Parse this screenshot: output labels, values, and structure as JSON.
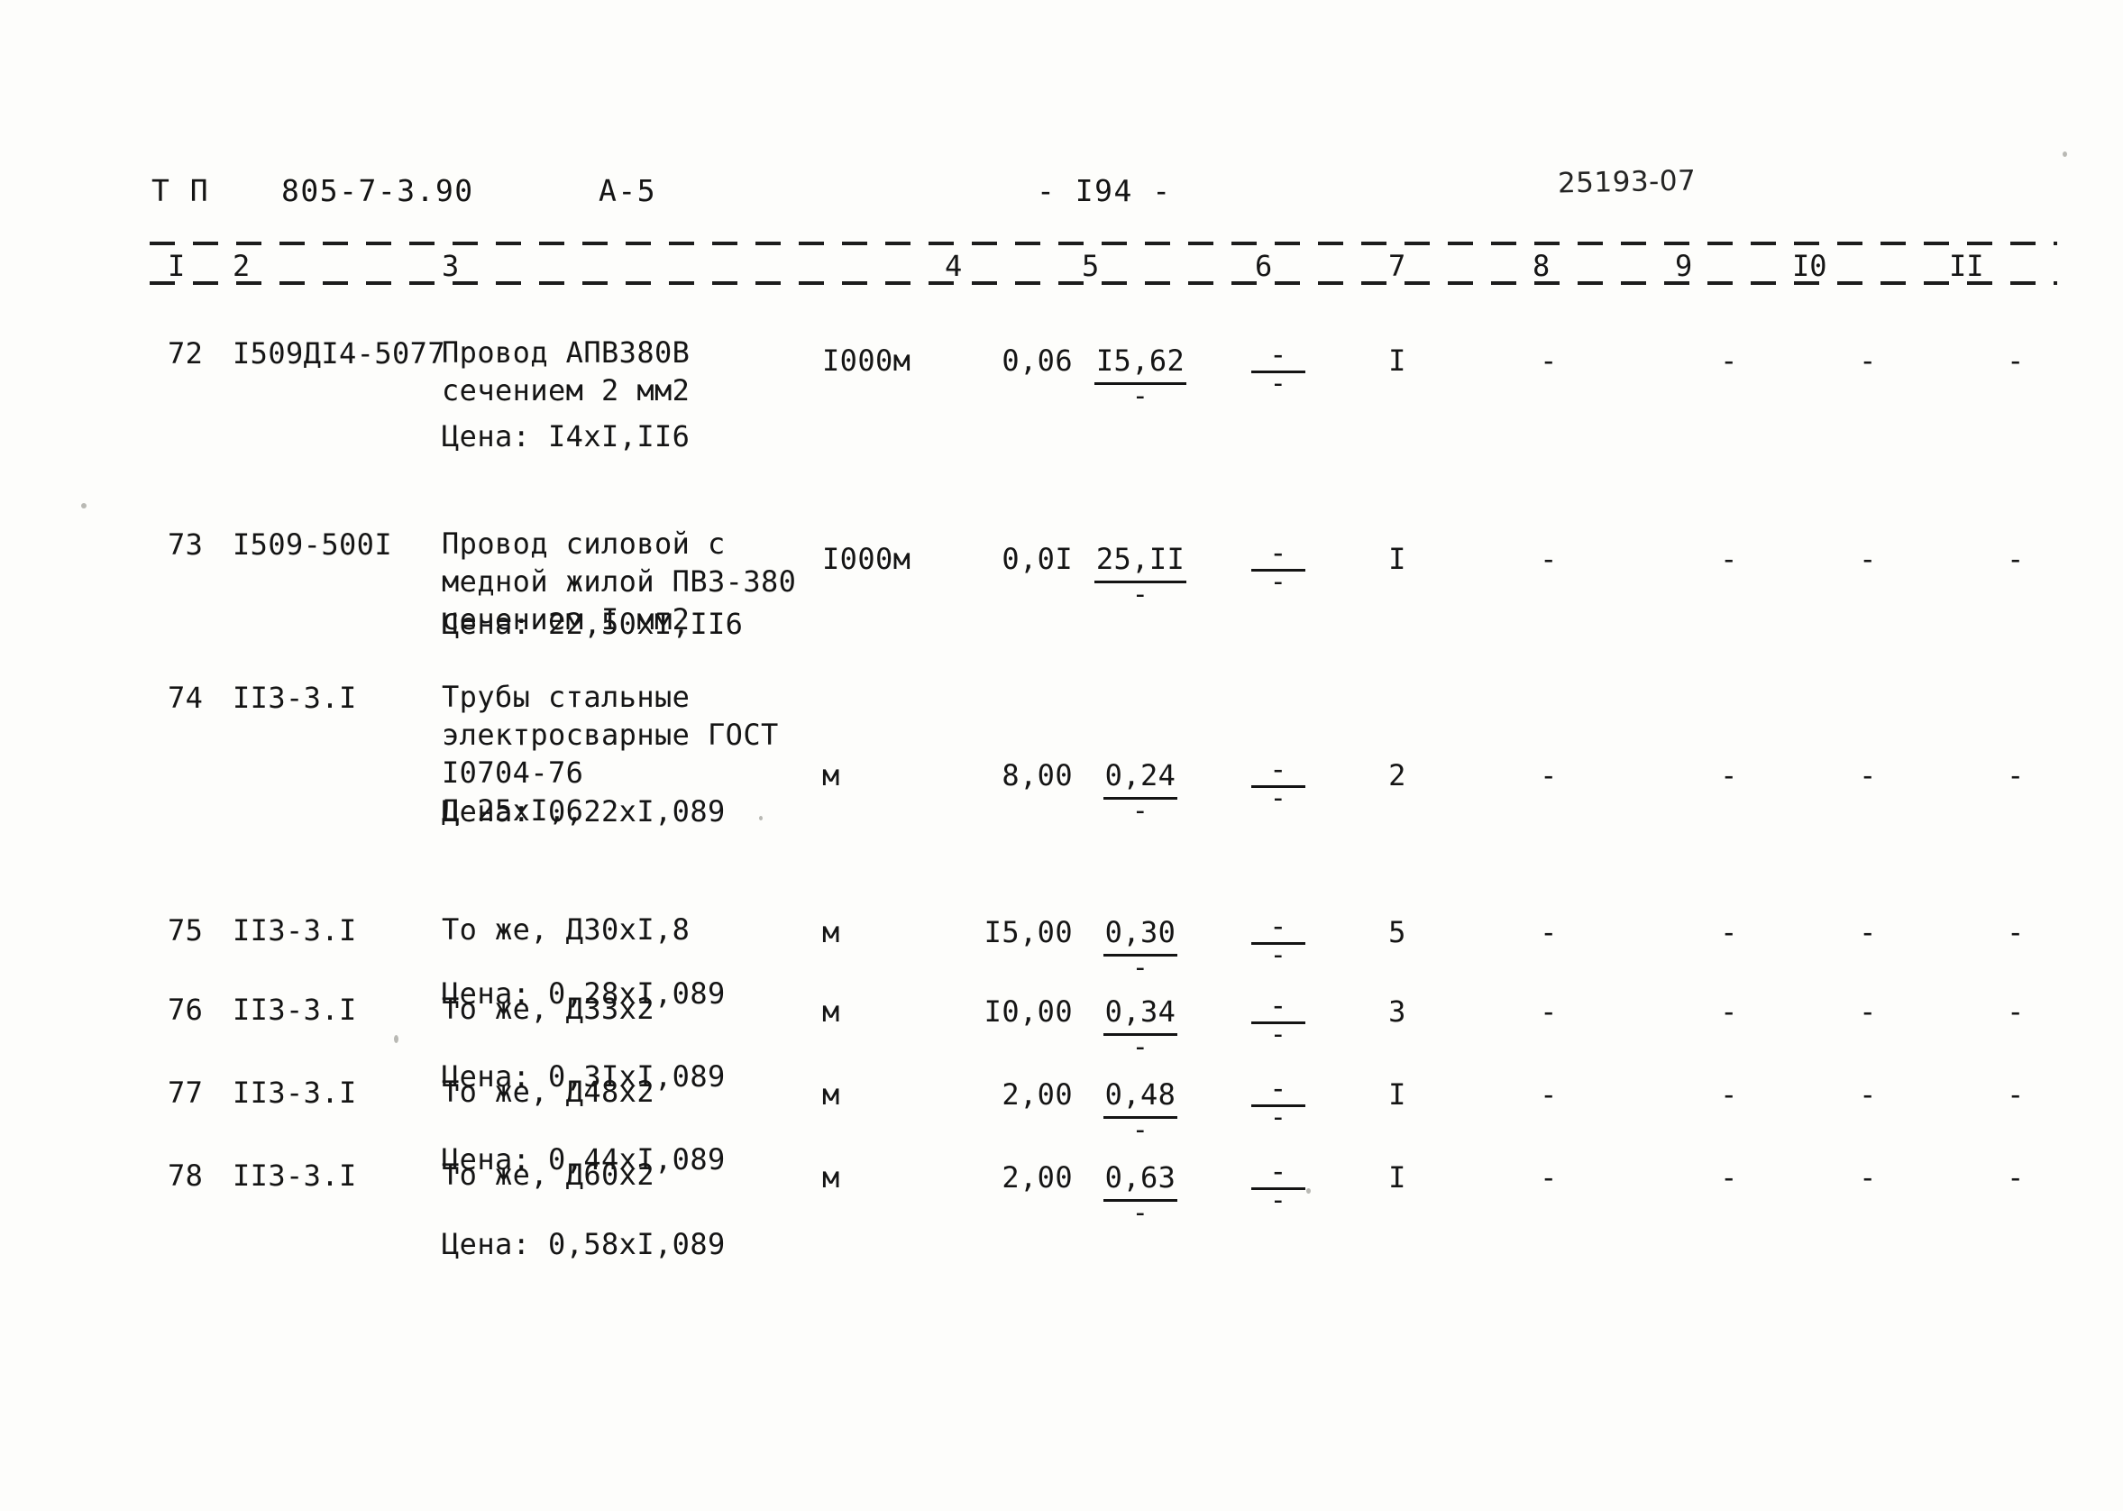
{
  "header": {
    "series_label": "Т П",
    "project_code": "805-7-3.90",
    "album": "А-5",
    "page_number": "- I94 -",
    "archive_stamp": "25193-07"
  },
  "table": {
    "column_numbers": [
      "I",
      "2",
      "3",
      "4",
      "5",
      "6",
      "7",
      "8",
      "9",
      "I0",
      "II"
    ],
    "rows": [
      {
        "pos": "72",
        "code_line1": "I509ДI4",
        "code_line2": "-5077",
        "name_line1": "Провод АПВЗ80В",
        "name_line2": "сечением 2 мм2",
        "name_line3": "",
        "name_line4": "",
        "price_note": "Цена: I4xI,II6",
        "unit": "I000м",
        "qty": "0,06",
        "price": "I5,62",
        "price_den": "-",
        "col6_top": "-",
        "col6_bot": "-",
        "col7": "I",
        "col8": "-",
        "col9": "-",
        "col10": "-",
        "col11": "-"
      },
      {
        "pos": "73",
        "code_line1": "I509-500I",
        "code_line2": "",
        "name_line1": "Провод силовой с",
        "name_line2": "медной жилой ПВЗ-380",
        "name_line3": "сечением I мм2",
        "name_line4": "",
        "price_note": "Цена: 22,50xI,II6",
        "unit": "I000м",
        "qty": "0,0I",
        "price": "25,II",
        "price_den": "-",
        "col6_top": "-",
        "col6_bot": "-",
        "col7": "I",
        "col8": "-",
        "col9": "-",
        "col10": "-",
        "col11": "-"
      },
      {
        "pos": "74",
        "code_line1": "II3-3.I",
        "code_line2": "",
        "name_line1": "Трубы стальные",
        "name_line2": "электросварные ГОСТ",
        "name_line3": "I0704-76",
        "name_line4": "Д 25xI,6",
        "price_note": "Цена: 0,22xI,089",
        "unit": "м",
        "qty": "8,00",
        "price": "0,24",
        "price_den": "-",
        "col6_top": "-",
        "col6_bot": "-",
        "col7": "2",
        "col8": "-",
        "col9": "-",
        "col10": "-",
        "col11": "-"
      },
      {
        "pos": "75",
        "code_line1": "II3-3.I",
        "code_line2": "",
        "name_line1": "То же, Д30xI,8",
        "name_line2": "",
        "name_line3": "",
        "name_line4": "",
        "price_note": "Цена: 0,28xI,089",
        "unit": "м",
        "qty": "I5,00",
        "price": "0,30",
        "price_den": "-",
        "col6_top": "-",
        "col6_bot": "-",
        "col7": "5",
        "col8": "-",
        "col9": "-",
        "col10": "-",
        "col11": "-"
      },
      {
        "pos": "76",
        "code_line1": "II3-3.I",
        "code_line2": "",
        "name_line1": "То же, Д33x2",
        "name_line2": "",
        "name_line3": "",
        "name_line4": "",
        "price_note": "Цена: 0,3IxI,089",
        "unit": "м",
        "qty": "I0,00",
        "price": "0,34",
        "price_den": "-",
        "col6_top": "-",
        "col6_bot": "-",
        "col7": "3",
        "col8": "-",
        "col9": "-",
        "col10": "-",
        "col11": "-"
      },
      {
        "pos": "77",
        "code_line1": "II3-3.I",
        "code_line2": "",
        "name_line1": "То же, Д48x2",
        "name_line2": "",
        "name_line3": "",
        "name_line4": "",
        "price_note": "Цена: 0,44xI,089",
        "unit": "м",
        "qty": "2,00",
        "price": "0,48",
        "price_den": "-",
        "col6_top": "-",
        "col6_bot": "-",
        "col7": "I",
        "col8": "-",
        "col9": "-",
        "col10": "-",
        "col11": "-"
      },
      {
        "pos": "78",
        "code_line1": "II3-3.I",
        "code_line2": "",
        "name_line1": "То же, Д60x2",
        "name_line2": "",
        "name_line3": "",
        "name_line4": "",
        "price_note": "Цена: 0,58xI,089",
        "unit": "м",
        "qty": "2,00",
        "price": "0,63",
        "price_den": "-",
        "col6_top": "-",
        "col6_bot": "-",
        "col7": "I",
        "col8": "-",
        "col9": "-",
        "col10": "-",
        "col11": "-"
      }
    ]
  }
}
